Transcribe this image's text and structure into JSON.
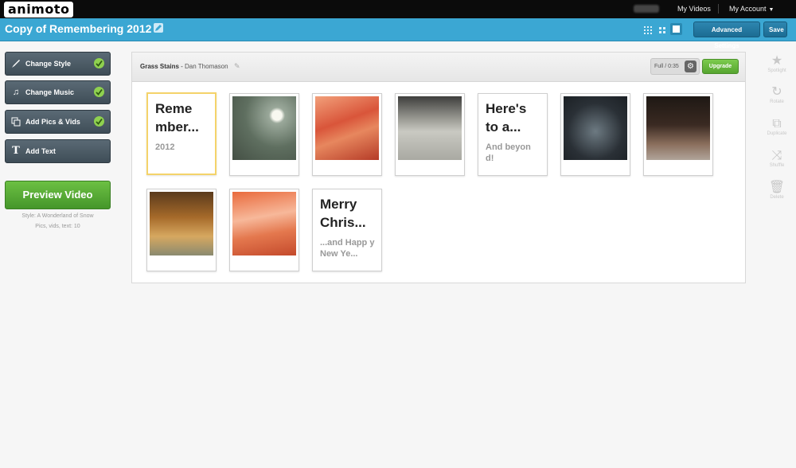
{
  "app": {
    "logo": "animoto"
  },
  "topnav": {
    "username_redacted": "",
    "my_videos": "My Videos",
    "my_account": "My Account"
  },
  "titlebar": {
    "title": "Copy of Remembering 2012",
    "advanced_settings": "Advanced Settings",
    "save": "Save"
  },
  "sidebar": {
    "items": [
      {
        "label": "Change Style",
        "icon": "brush-icon",
        "done": true
      },
      {
        "label": "Change Music",
        "icon": "music-note-icon",
        "done": true
      },
      {
        "label": "Add Pics & Vids",
        "icon": "pics-icon",
        "done": true
      },
      {
        "label": "Add Text",
        "icon": "text-icon",
        "done": false
      }
    ],
    "preview": "Preview Video",
    "style_info": "Style: A Wonderland of Snow",
    "count_info": "Pics, vids, text: 10"
  },
  "music": {
    "song": "Grass Stains",
    "separator": " - ",
    "artist": "Dan Thomason",
    "duration": "Full / 0:35",
    "upgrade": "Upgrade"
  },
  "cards": [
    {
      "type": "text",
      "title": "Reme mber...",
      "sub": "2012"
    },
    {
      "type": "photo",
      "desc": "snowy night lamp"
    },
    {
      "type": "photo",
      "desc": "orange snow"
    },
    {
      "type": "photo",
      "desc": "snowy field"
    },
    {
      "type": "text",
      "title": "Here's to a...",
      "sub": "And beyon d!"
    },
    {
      "type": "photo",
      "desc": "night park trees"
    },
    {
      "type": "photo",
      "desc": "tree lined path"
    },
    {
      "type": "photo",
      "desc": "forest sunlight"
    },
    {
      "type": "photo",
      "desc": "orange snow drift"
    },
    {
      "type": "text",
      "title": "Merry Chris...",
      "sub": "...and Happ y New Ye..."
    }
  ],
  "tools": [
    {
      "label": "Spotlight",
      "icon": "star-icon"
    },
    {
      "label": "Rotate",
      "icon": "rotate-icon"
    },
    {
      "label": "Duplicate",
      "icon": "duplicate-icon"
    },
    {
      "label": "Shuffle",
      "icon": "shuffle-icon"
    },
    {
      "label": "Delete",
      "icon": "trash-icon"
    }
  ],
  "colors": {
    "topbar": "#0b0b0b",
    "titlebar": "#3ba7d3",
    "preview": "#5aad38",
    "check": "#8fd14f",
    "selected_border": "#f4d36a"
  }
}
